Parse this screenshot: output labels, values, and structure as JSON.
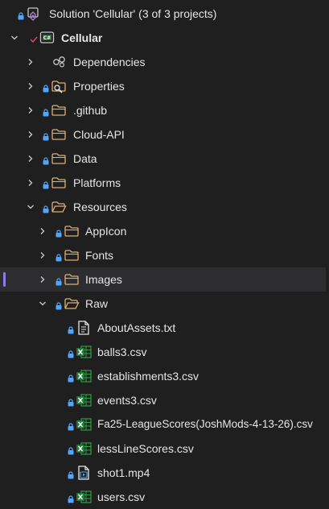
{
  "solution_explorer": {
    "solution_label": "Solution 'Cellular' (3 of 3 projects)",
    "project_label": "Cellular",
    "nodes": {
      "dependencies": "Dependencies",
      "properties": "Properties",
      "github": ".github",
      "cloud_api": "Cloud-API",
      "data": "Data",
      "platforms": "Platforms",
      "resources": "Resources",
      "appicon": "AppIcon",
      "fonts": "Fonts",
      "images": "Images",
      "raw": "Raw"
    },
    "files": [
      {
        "name": "AboutAssets.txt",
        "icon": "text-file-icon"
      },
      {
        "name": "balls3.csv",
        "icon": "excel-icon"
      },
      {
        "name": "establishments3.csv",
        "icon": "excel-icon"
      },
      {
        "name": "events3.csv",
        "icon": "excel-icon"
      },
      {
        "name": "Fa25-LeagueScores(JoshMods-4-13-26).csv",
        "icon": "excel-icon"
      },
      {
        "name": "lessLineScores.csv",
        "icon": "excel-icon"
      },
      {
        "name": "shot1.mp4",
        "icon": "video-file-icon"
      },
      {
        "name": "users.csv",
        "icon": "excel-icon"
      }
    ]
  },
  "colors": {
    "background": "#1f1f1f",
    "selected_row": "#2d2d30",
    "selection_bar": "#8c7ee6",
    "lock_blue": "#4fa6ff",
    "folder_tan": "#d9b072",
    "excel_green": "#2ea043",
    "check_red": "#e84a5f"
  }
}
